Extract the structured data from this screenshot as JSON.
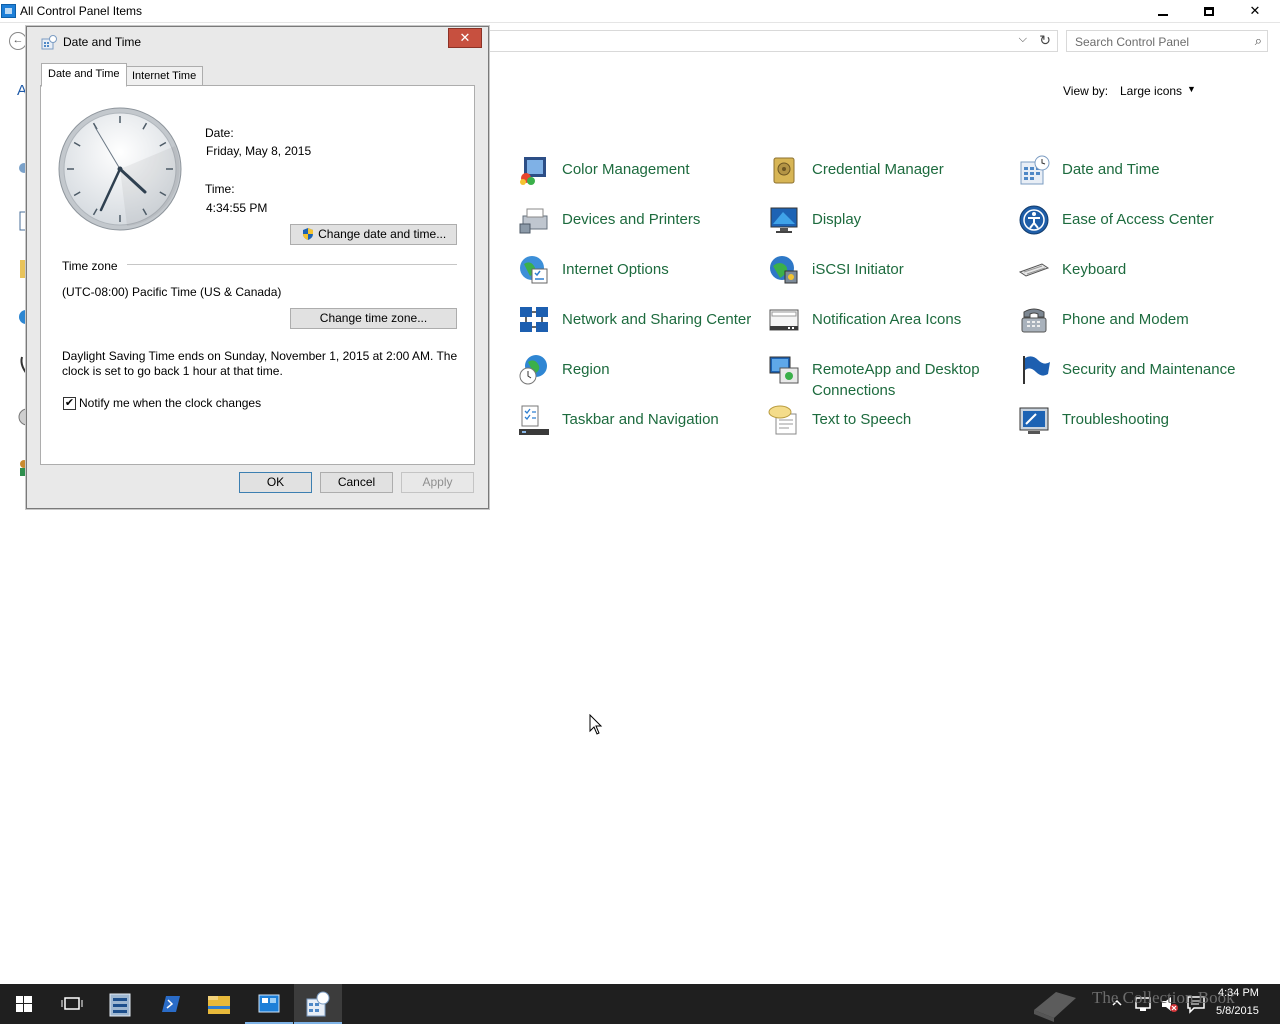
{
  "window": {
    "title": "All Control Panel Items",
    "minimize_glyph": "",
    "close_glyph": "✕"
  },
  "address": {
    "search_placeholder": "Search Control Panel"
  },
  "view": {
    "label": "View by:",
    "value": "Large icons"
  },
  "left_fragment": "A",
  "items": [
    {
      "label": "Color Management",
      "icon": "color-management-icon"
    },
    {
      "label": "Credential Manager",
      "icon": "credential-manager-icon"
    },
    {
      "label": "Date and Time",
      "icon": "date-time-icon"
    },
    {
      "label": "Devices and Printers",
      "icon": "devices-printers-icon"
    },
    {
      "label": "Display",
      "icon": "display-icon"
    },
    {
      "label": "Ease of Access Center",
      "icon": "ease-of-access-icon"
    },
    {
      "label": "Internet Options",
      "icon": "internet-options-icon"
    },
    {
      "label": "iSCSI Initiator",
      "icon": "iscsi-icon"
    },
    {
      "label": "Keyboard",
      "icon": "keyboard-icon"
    },
    {
      "label": "Network and Sharing Center",
      "icon": "network-icon"
    },
    {
      "label": "Notification Area Icons",
      "icon": "notification-icon"
    },
    {
      "label": "Phone and Modem",
      "icon": "phone-icon"
    },
    {
      "label": "Region",
      "icon": "region-icon"
    },
    {
      "label": "RemoteApp and Desktop Connections",
      "icon": "remoteapp-icon"
    },
    {
      "label": "Security and Maintenance",
      "icon": "security-flag-icon"
    },
    {
      "label": "Taskbar and Navigation",
      "icon": "taskbar-icon"
    },
    {
      "label": "Text to Speech",
      "icon": "speech-icon"
    },
    {
      "label": "Troubleshooting",
      "icon": "troubleshooting-icon"
    }
  ],
  "dialog": {
    "title": "Date and Time",
    "close_glyph": "✕",
    "tabs": [
      "Date and Time",
      "Internet Time"
    ],
    "date_label": "Date:",
    "date_value": "Friday, May 8, 2015",
    "time_label": "Time:",
    "time_value": "4:34:55 PM",
    "change_datetime_btn": "Change date and time...",
    "timezone_heading": "Time zone",
    "timezone_value": "(UTC-08:00) Pacific Time (US & Canada)",
    "change_timezone_btn": "Change time zone...",
    "dst_line1": "Daylight Saving Time ends on Sunday, November 1, 2015 at 2:00 AM. The",
    "dst_line2": "clock is set to go back 1 hour at that time.",
    "notify_label": "Notify me when the clock changes",
    "notify_checked": "✔",
    "ok": "OK",
    "cancel": "Cancel",
    "apply": "Apply"
  },
  "taskbar": {
    "time": "4:34 PM",
    "date": "5/8/2015",
    "watermark": "The Collection Book"
  }
}
